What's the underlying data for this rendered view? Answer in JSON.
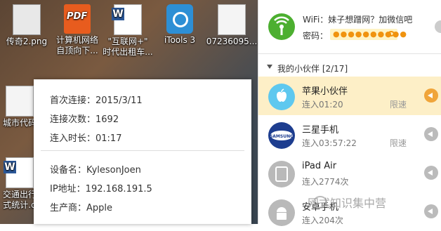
{
  "desktop": {
    "icons": [
      {
        "label1": "传奇2.png",
        "label2": ""
      },
      {
        "label1": "计算机网络",
        "label2": "自顶向下..."
      },
      {
        "label1": "\"互联网+\"",
        "label2": "时代出租车..."
      },
      {
        "label1": "iTools 3",
        "label2": ""
      },
      {
        "label1": "07236095...",
        "label2": ""
      },
      {
        "label1": "城市代码",
        "label2": ""
      },
      {
        "label1": "交通出行",
        "label2": "式统计.d"
      }
    ]
  },
  "tooltip": {
    "first_connect": "首次连接：2015/3/11",
    "connect_count": "连接次数：1692",
    "connect_duration": "连入时长：01:17",
    "device_name": "设备名：KylesonJoen",
    "ip": "IP地址：192.168.191.5",
    "vendor": "生产商：Apple"
  },
  "wifi": {
    "ssid_label": "WiFi：妹子想蹭网？加微信吧",
    "password_label": "密码：",
    "password_mask": "●●●●●●●●●●"
  },
  "friends": {
    "header": "我的小伙伴  [2/17]",
    "devices": [
      {
        "name": "苹果小伙伴",
        "status": "连入01:20",
        "limit": "限速",
        "icon": "apple-icon",
        "selected": true
      },
      {
        "name": "三星手机",
        "status": "连入03:57:22",
        "limit": "限速",
        "icon": "samsung-icon",
        "selected": false
      },
      {
        "name": "iPad Air",
        "status": "连入2774次",
        "limit": "",
        "icon": "ipad-icon",
        "selected": false
      },
      {
        "name": "安卓手机",
        "status": "连入204次",
        "limit": "",
        "icon": "android-icon",
        "selected": false
      }
    ]
  },
  "watermark": "网式知识集中营",
  "colors": {
    "accent": "#f0a53a",
    "wifi_green": "#4caf30",
    "selected_bg": "#fdefc7"
  }
}
